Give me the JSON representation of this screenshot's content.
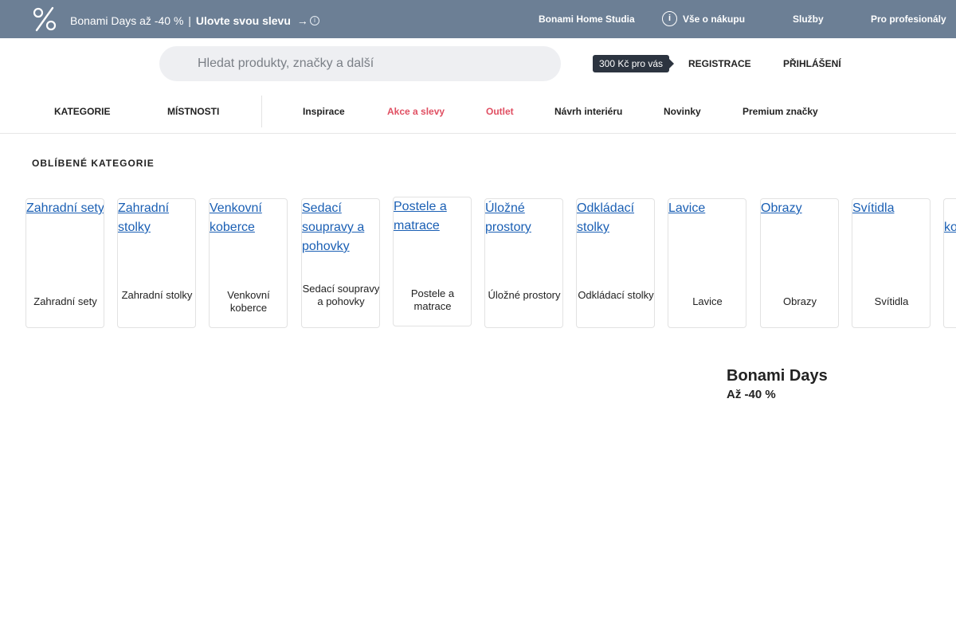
{
  "topbar": {
    "promo_text": "Bonami Days až -40 %",
    "promo_separator": "|",
    "promo_cta": "Ulovte svou slevu",
    "promo_arrow": "→",
    "info_icon": "i",
    "links": {
      "home_studia": "Bonami Home Studia",
      "vse_o_nakupu": "Vše o nákupu",
      "sluzby": "Služby",
      "pro_profesionaly": "Pro profesionály"
    },
    "color": "#6c7f95"
  },
  "search": {
    "placeholder": "Hledat produkty, značky a další"
  },
  "account": {
    "badge": "300 Kč pro vás",
    "register": "REGISTRACE",
    "login": "PŘIHLÁŠENÍ"
  },
  "nav": {
    "kategorie": "KATEGORIE",
    "mistnosti": "MÍSTNOSTI",
    "inspirace": "Inspirace",
    "akce": "Akce a slevy",
    "outlet": "Outlet",
    "navrh": "Návrh interiéru",
    "novinky": "Novinky",
    "premium": "Premium značky",
    "accent_color": "#e04f62"
  },
  "categories": {
    "title": "OBLÍBENÉ KATEGORIE",
    "items": [
      {
        "alt": "Zahradní sety",
        "label": "Zahradní sety"
      },
      {
        "alt": "Zahradní stolky",
        "label": "Zahradní stolky"
      },
      {
        "alt": "Venkovní koberce",
        "label": "Venkovní koberce"
      },
      {
        "alt": "Sedací soupravy a pohovky",
        "label": "Sedací soupravy a pohovky"
      },
      {
        "alt": "Postele a matrace",
        "label": "Postele a matrace"
      },
      {
        "alt": "Úložné prostory",
        "label": "Úložné prostory"
      },
      {
        "alt": "Odkládací stolky",
        "label": "Odkládací stolky"
      },
      {
        "alt": "Lavice",
        "label": "Lavice"
      },
      {
        "alt": "Obrazy",
        "label": "Obrazy"
      },
      {
        "alt": "Svítidla",
        "label": "Svítidla"
      },
      {
        "alt": "ko",
        "label": ""
      }
    ]
  },
  "promo_block": {
    "title": "Bonami Days",
    "subtitle": "Až -40 %"
  }
}
